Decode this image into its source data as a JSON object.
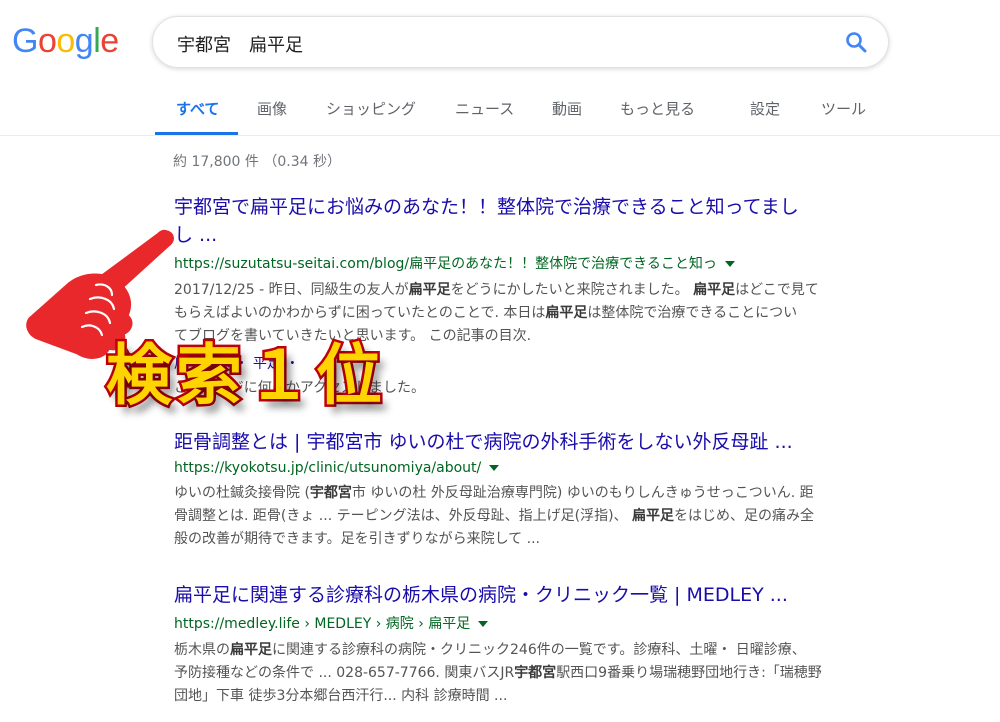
{
  "logo": {
    "letters": [
      "G",
      "o",
      "o",
      "g",
      "l",
      "e"
    ],
    "colors": [
      "#4285F4",
      "#EA4335",
      "#FBBC05",
      "#4285F4",
      "#34A853",
      "#EA4335"
    ]
  },
  "search": {
    "query": "宇都宮　扁平足"
  },
  "tabs": [
    {
      "label": "すべて",
      "active": true
    },
    {
      "label": "画像"
    },
    {
      "label": "ショッピング"
    },
    {
      "label": "ニュース"
    },
    {
      "label": "動画"
    },
    {
      "label": "もっと見る"
    },
    {
      "label": "設定"
    },
    {
      "label": "ツール"
    }
  ],
  "stats": "約 17,800 件 （0.34 秒）",
  "results": [
    {
      "title_l1": "宇都宮で扁平足にお悩みのあなた！！整体院で治療できること知ってまし",
      "title_l2": "し ...",
      "url": "https://suzutatsu-seitai.com/blog/扁平足のあなた！！整体院で治療できること知っ",
      "snippet": [
        "2017/12/25 - 昨日、同級生の友人が<b>扁平足</b>をどうにかしたいと来院されました。 <b>扁平足</b>はどこで見て",
        "もらえばよいのかわからずに困っていたとのことで. 本日は<b>扁平足</b>は整体院で治療できることについ",
        "てブログを書いていきたいと思います。 この記事の目次."
      ],
      "extra_l1": "扁平足は ・ 平足 ・",
      "extra_l2": "このページに何度かアクセスしました。"
    },
    {
      "title_l1": "距骨調整とは | 宇都宮市 ゆいの杜で病院の外科手術をしない外反母趾 ...",
      "url": "https://kyokotsu.jp/clinic/utsunomiya/about/",
      "snippet": [
        "ゆいの杜鍼灸接骨院 (<b>宇都宮</b>市 ゆいの杜 外反母趾治療専門院) ゆいのもりしんきゅうせっこついん. 距",
        "骨調整とは. 距骨(きょ ... テーピング法は、外反母趾、指上げ足(浮指)、 <b>扁平足</b>をはじめ、足の痛み全",
        "般の改善が期待できます。足を引きずりながら来院して ..."
      ]
    },
    {
      "title_l1": "扁平足に関連する診療科の栃木県の病院・クリニック一覧 | MEDLEY ...",
      "url": "https://medley.life › MEDLEY › 病院 › 扁平足",
      "snippet": [
        "栃木県の<b>扁平足</b>に関連する診療科の病院・クリニック246件の一覧です。診療科、土曜・ 日曜診療、",
        "予防接種などの条件で ... 028-657-7766. 関東バスJR<b>宇都宮</b>駅西口9番乗り場瑞穂野団地行き:「瑞穂野",
        "団地」下車 徒歩3分本郷台西汗行... 内科 診療時間 ..."
      ]
    }
  ],
  "overlay": {
    "text": "検索１位",
    "fill": "#ffd400",
    "stroke": "#c0000a"
  },
  "hand": {
    "color": "#e8282b"
  }
}
